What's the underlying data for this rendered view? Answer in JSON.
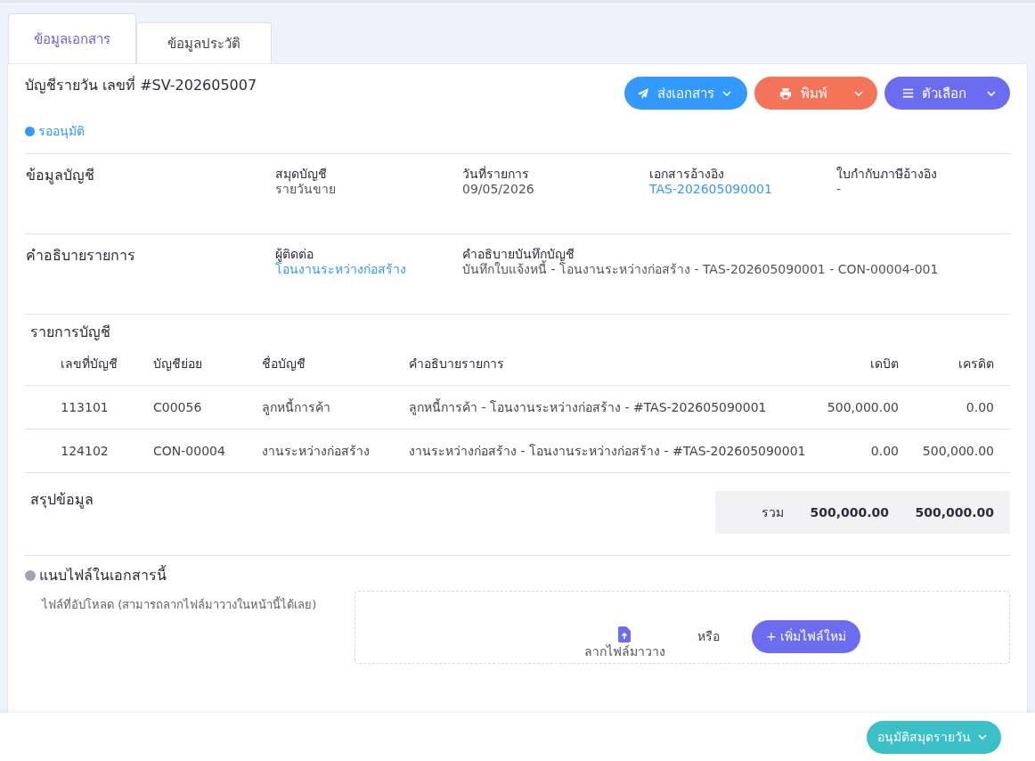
{
  "tabs": [
    {
      "label": "ข้อมูลเอกสาร",
      "selected": true
    },
    {
      "label": "ข้อมูลประวัติ",
      "selected": false
    }
  ],
  "document": {
    "title": "บัญชีรายวัน เลขที่ #SV-202605007",
    "status": "รออนุมัติ"
  },
  "actions": [
    {
      "kind": "send",
      "label": "ส่งเอกสาร",
      "color": "#3399ff"
    },
    {
      "kind": "print",
      "label": "พิมพ์",
      "color": "#f4745a"
    },
    {
      "kind": "options",
      "label": "ตัวเลือก",
      "color": "#6c6cf0"
    }
  ],
  "sections": [
    {
      "title": "ข้อมูลบัญชี",
      "fields": [
        {
          "label": "สมุดบัญชี",
          "value": "รายวันขาย",
          "link": false
        },
        {
          "label": "วันที่รายการ",
          "value": "09/05/2026",
          "link": false
        },
        {
          "label": "เอกสารอ้างอิง",
          "value": "TAS-202605090001",
          "link": true
        },
        {
          "label": "ใบกำกับภาษีอ้างอิง",
          "value": "-",
          "link": false
        }
      ]
    },
    {
      "title": "คำอธิบายรายการ",
      "fields": [
        {
          "label": "ผู้ติดต่อ",
          "value": "โอนงานระหว่างก่อสร้าง",
          "link": true
        },
        {
          "label": "คำอธิบายบันทึกบัญชี",
          "value": "บันทึกใบแจ้งหนี้ - โอนงานระหว่างก่อสร้าง - TAS-202605090001 - CON-00004-001",
          "link": false
        }
      ]
    }
  ],
  "entries": {
    "title": "รายการบัญชี",
    "columns": [
      "เลขที่บัญชี",
      "บัญชีย่อย",
      "ชื่อบัญชี",
      "คำอธิบายรายการ",
      "เดบิต",
      "เครดิต"
    ],
    "rows": [
      [
        "113101",
        "C00056",
        "ลูกหนี้การค้า",
        "ลูกหนี้การค้า - โอนงานระหว่างก่อสร้าง - #TAS-202605090001",
        "500,000.00",
        "0.00"
      ],
      [
        "124102",
        "CON-00004",
        "งานระหว่างก่อสร้าง",
        "งานระหว่างก่อสร้าง - โอนงานระหว่างก่อสร้าง - #TAS-202605090001",
        "0.00",
        "500,000.00"
      ]
    ]
  },
  "summary": {
    "title": "สรุปข้อมูล",
    "label": "รวม",
    "debit": "500,000.00",
    "credit": "500,000.00"
  },
  "attachments": {
    "title": "แนบไฟล์ในเอกสารนี้",
    "hint": "ไฟล์ที่อัปโหลด (สามารถลากไฟล์มาวางในหน้านี้ได้เลย)",
    "drop_label": "ลากไฟล์มาวาง",
    "or": "หรือ",
    "add_button": "+ เพิ่มไฟล์ใหม่"
  },
  "footer": {
    "approve_button": "อนุมัติสมุดรายวัน"
  }
}
